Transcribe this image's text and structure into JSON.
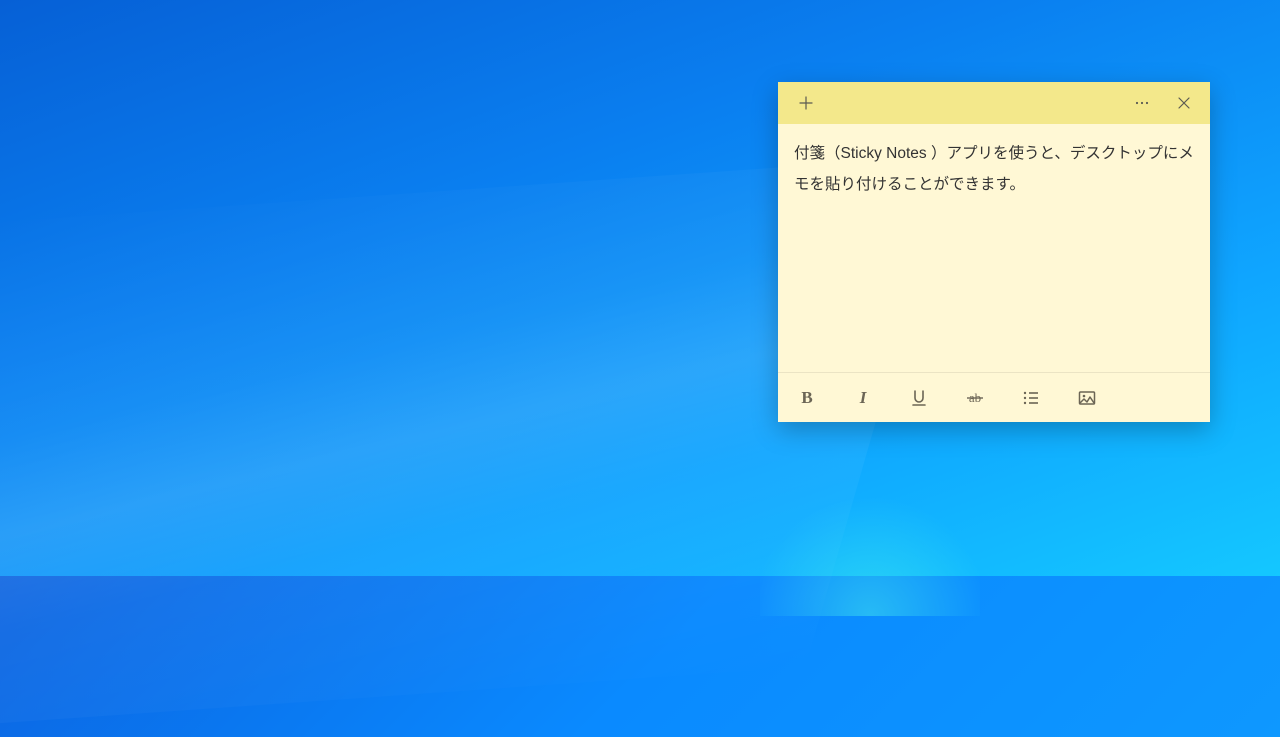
{
  "note": {
    "content": "付箋（Sticky Notes ）アプリを使うと、デスクトップにメモを貼り付けることができます。"
  },
  "titlebar": {
    "new_note": "+",
    "menu": "...",
    "close": "✕"
  },
  "toolbar": {
    "bold": "B",
    "italic": "I",
    "underline": "U",
    "strikethrough": "ab",
    "bullet_list": "list",
    "image": "image"
  }
}
